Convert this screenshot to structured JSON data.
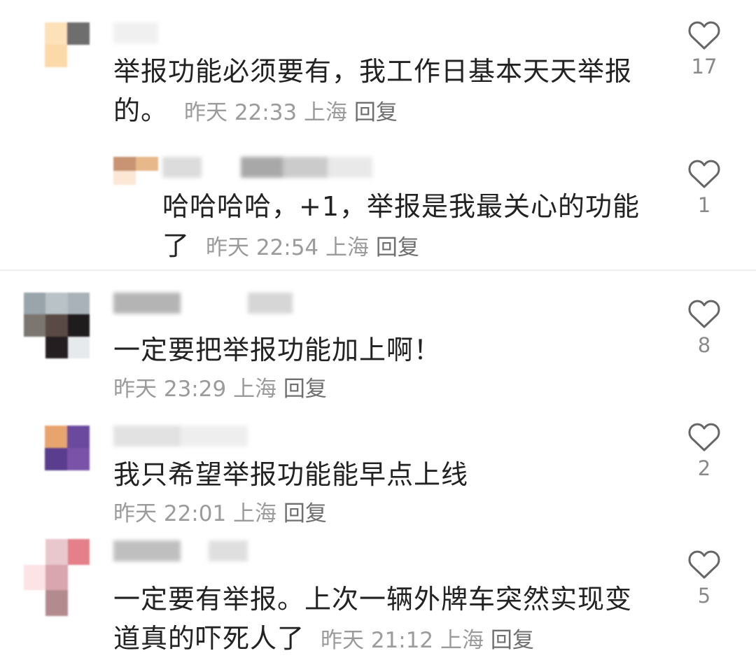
{
  "comments": [
    {
      "text": "举报功能必须要有，我工作日基本天天举报",
      "text2": "的。",
      "time": "昨天 22:33",
      "location": "上海",
      "reply_label": "回复",
      "likes": "17"
    },
    {
      "text": "哈哈哈哈，+1，举报是我最关心的功能",
      "text2": "了",
      "time": "昨天 22:54",
      "location": "上海",
      "reply_label": "回复",
      "likes": "1"
    },
    {
      "text": "一定要把举报功能加上啊！",
      "time": "昨天 23:29",
      "location": "上海",
      "reply_label": "回复",
      "likes": "8"
    },
    {
      "text": "我只希望举报功能能早点上线",
      "time": "昨天 22:01",
      "location": "上海",
      "reply_label": "回复",
      "likes": "2"
    },
    {
      "text": "一定要有举报。上次一辆外牌车突然实现变",
      "text2": "道真的吓死人了",
      "time": "昨天 21:12",
      "location": "上海",
      "reply_label": "回复",
      "likes": "5"
    }
  ],
  "icons": {
    "like": "heart-outline-icon"
  },
  "colors": {
    "text": "#222222",
    "meta": "#9b9b9b",
    "reply": "#6f6f6f",
    "heart": "#666666"
  }
}
